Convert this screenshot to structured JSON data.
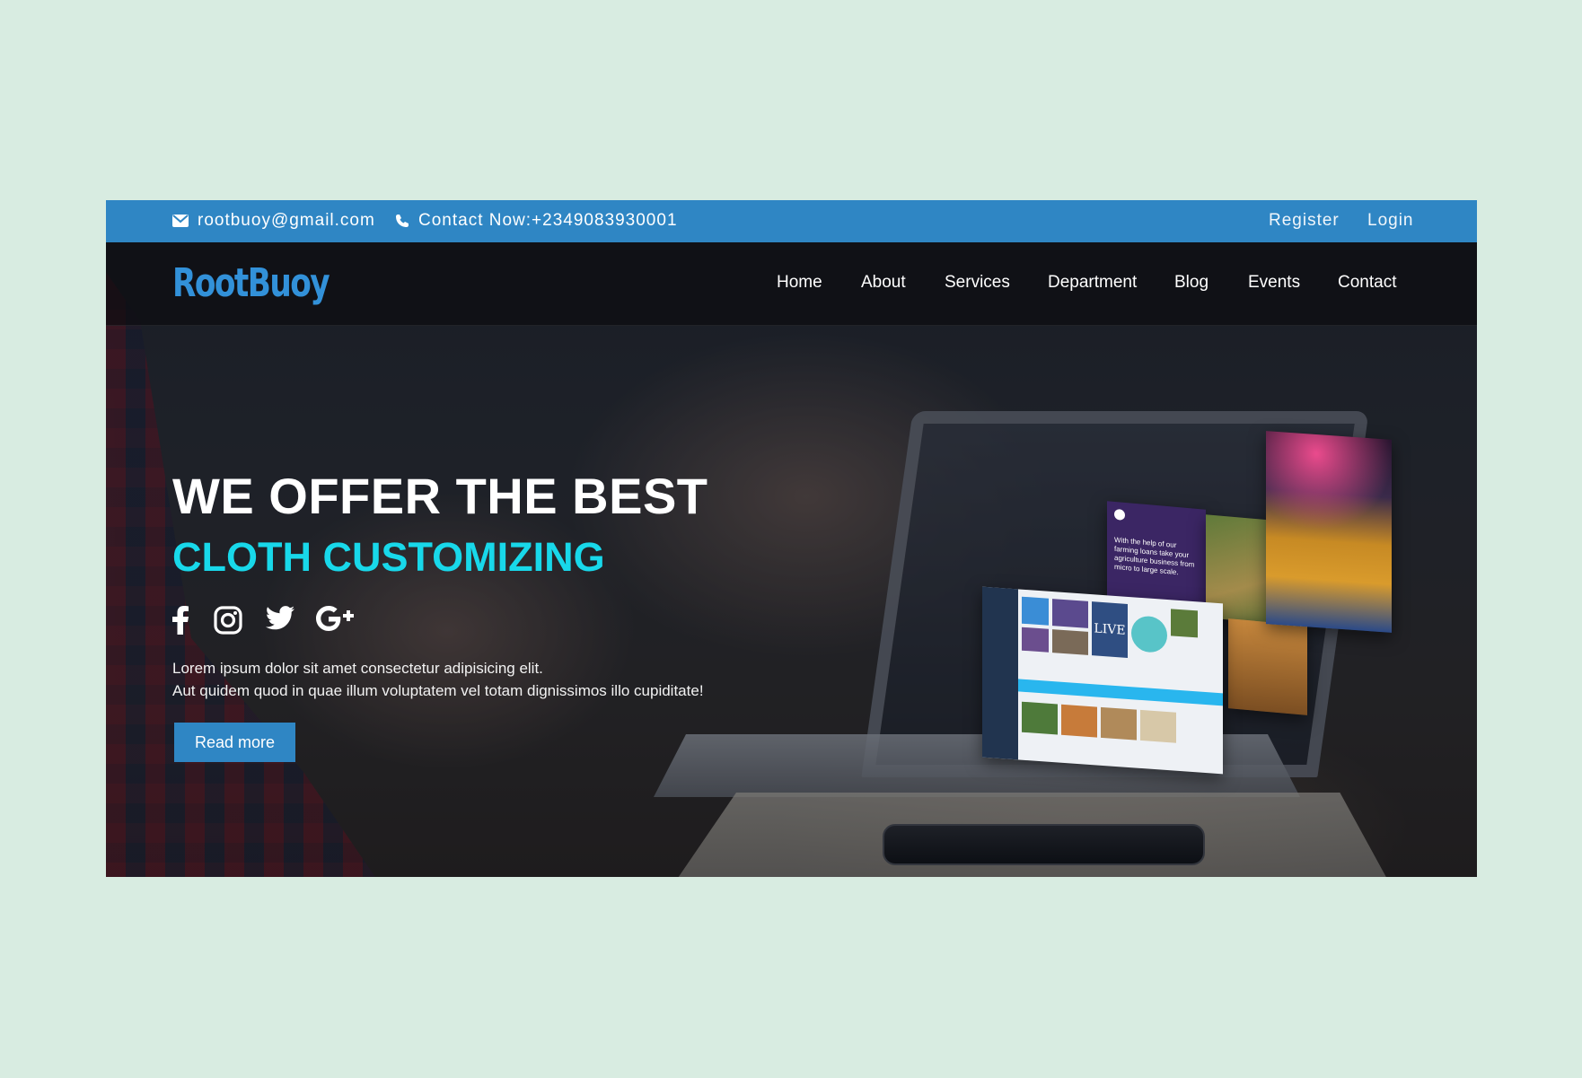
{
  "topbar": {
    "email": "rootbuoy@gmail.com",
    "phone": "Contact Now:+2349083930001",
    "register": "Register",
    "login": "Login"
  },
  "logo": "RootBuoy",
  "nav": [
    "Home",
    "About",
    "Services",
    "Department",
    "Blog",
    "Events",
    "Contact"
  ],
  "hero": {
    "headline": "WE OFFER THE BEST",
    "subheadline": "CLOTH CUSTOMIZING",
    "line1": "Lorem ipsum dolor sit amet consectetur adipisicing elit.",
    "line2": "Aut quidem quod in quae illum voluptatem vel totam dignissimos illo cupiditate!",
    "button": "Read more"
  },
  "mockup": {
    "purple_card_text": "With the help of our farming loans take your agriculture business from micro to large scale.",
    "tile_text": "LIVE"
  },
  "socials": [
    "facebook-icon",
    "instagram-icon",
    "twitter-icon",
    "google-plus-icon"
  ],
  "colors": {
    "accent": "#2f86c4",
    "highlight": "#18d8ea",
    "page_background": "#d8ece1"
  }
}
